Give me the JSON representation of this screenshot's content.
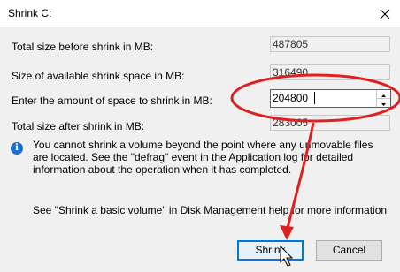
{
  "window": {
    "title": "Shrink C:"
  },
  "rows": [
    {
      "label": "Total size before shrink in MB:",
      "value": "487805"
    },
    {
      "label": "Size of available shrink space in MB:",
      "value": "316490"
    },
    {
      "label": "Enter the amount of space to shrink in MB:",
      "value": "204800"
    },
    {
      "label": "Total size after shrink in MB:",
      "value": "283005"
    }
  ],
  "info": {
    "icon": "info-icon",
    "glyph": "i",
    "text": "You cannot shrink a volume beyond the point where any unmovable files are located. See the \"defrag\" event in the Application log for detailed information about the operation when it has completed."
  },
  "help_text": "See \"Shrink a basic volume\" in Disk Management help for more information",
  "buttons": {
    "shrink": "Shrink",
    "cancel": "Cancel"
  },
  "annotation": {
    "color": "#e02020"
  }
}
